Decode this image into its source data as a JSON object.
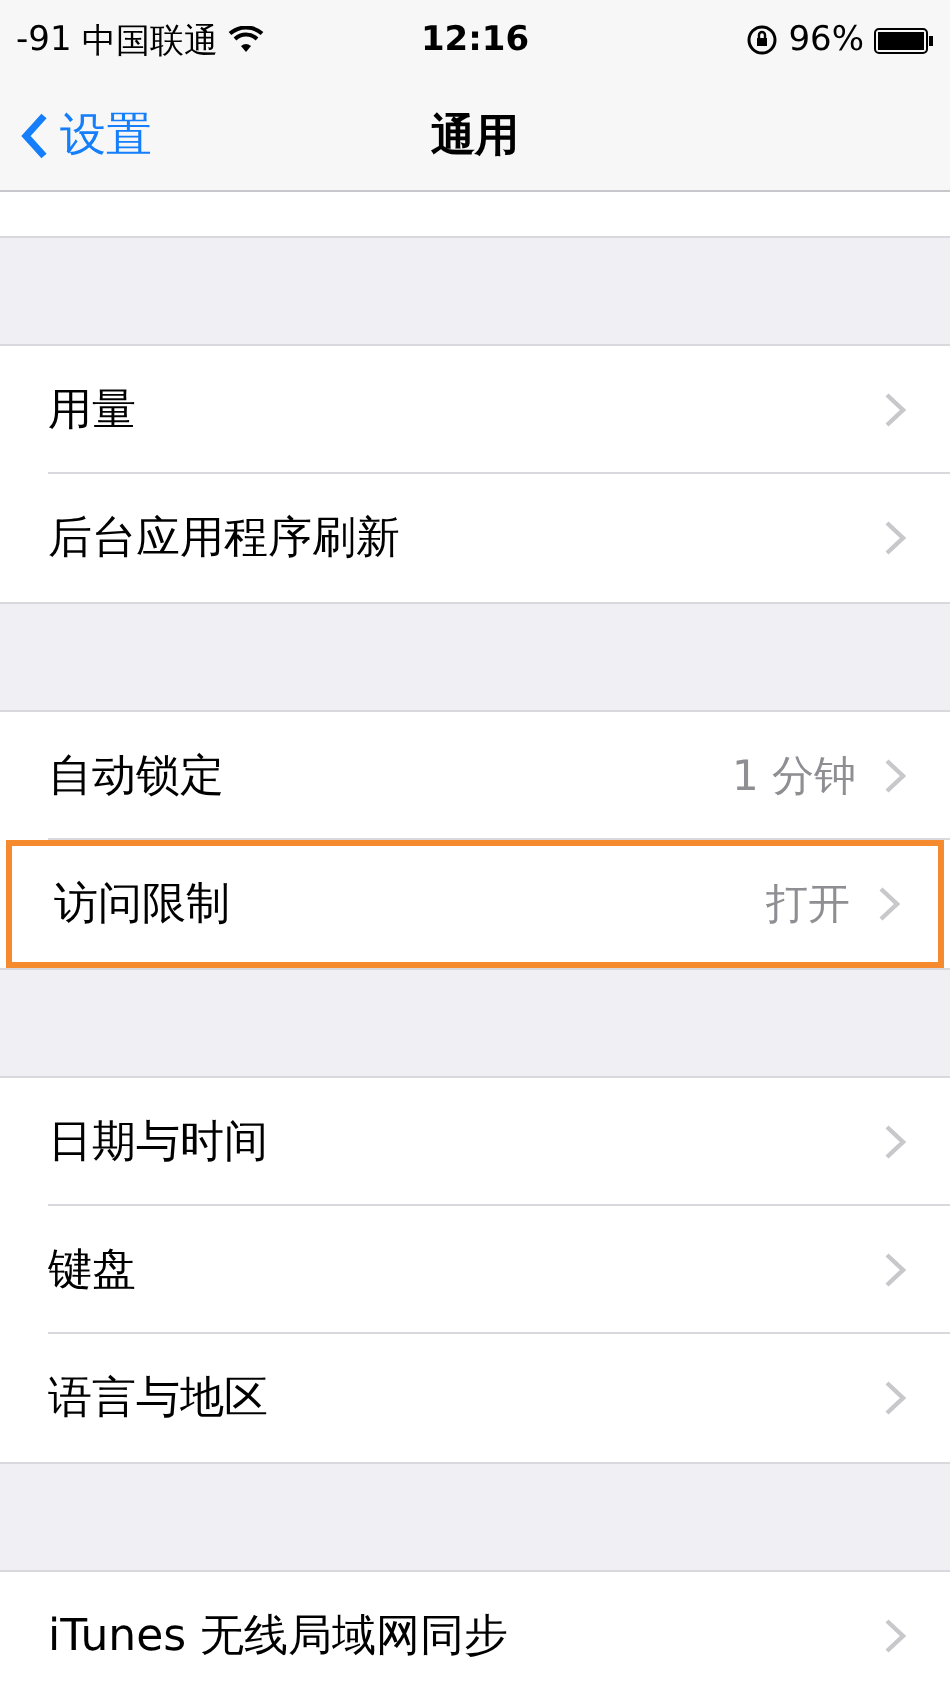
{
  "status_bar": {
    "signal": "-91",
    "carrier": "中国联通",
    "time": "12:16",
    "battery": "96%"
  },
  "nav": {
    "back": "设置",
    "title": "通用"
  },
  "groups": [
    {
      "rows": [
        {
          "label": "用量",
          "highlighted": false
        },
        {
          "label": "后台应用程序刷新",
          "highlighted": false
        }
      ]
    },
    {
      "rows": [
        {
          "label": "自动锁定",
          "value": "1 分钟",
          "highlighted": false
        },
        {
          "label": "访问限制",
          "value": "打开",
          "highlighted": true
        }
      ]
    },
    {
      "rows": [
        {
          "label": "日期与时间",
          "highlighted": false
        },
        {
          "label": "键盘",
          "highlighted": false
        },
        {
          "label": "语言与地区",
          "highlighted": false
        }
      ]
    },
    {
      "rows": [
        {
          "label": "iTunes 无线局域网同步",
          "highlighted": false
        }
      ]
    }
  ]
}
